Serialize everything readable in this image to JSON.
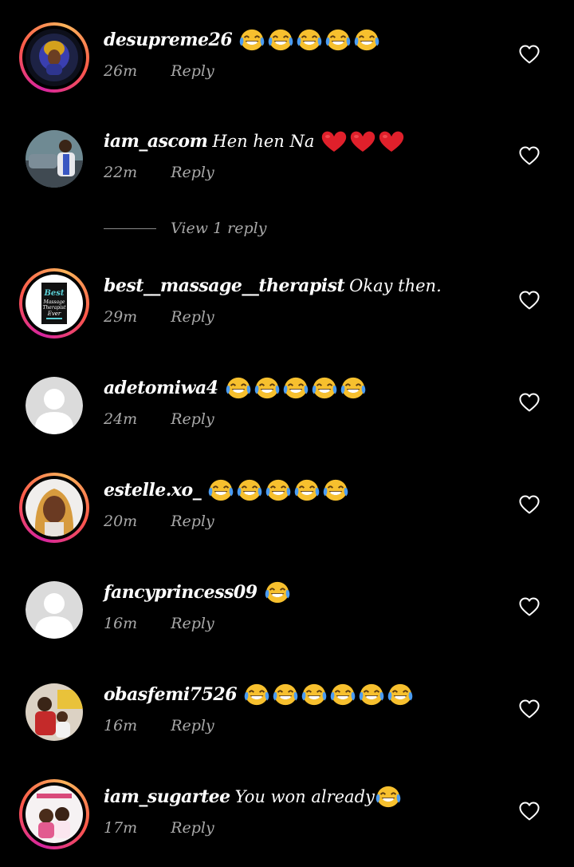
{
  "comments": [
    {
      "username": "desupreme26",
      "text": "",
      "emoji": "joy",
      "emoji_count": 5,
      "time": "26m",
      "reply_label": "Reply",
      "story_ring": true,
      "avatar": "woman-headwrap"
    },
    {
      "username": "iam_ascom",
      "text": "Hen hen Na",
      "emoji": "heart",
      "emoji_count": 3,
      "time": "22m",
      "reply_label": "Reply",
      "story_ring": false,
      "avatar": "man-car"
    },
    {
      "username": "best__massage__therapist",
      "text": "Okay then.",
      "emoji": "",
      "emoji_count": 0,
      "time": "29m",
      "reply_label": "Reply",
      "story_ring": true,
      "avatar": "mug-logo"
    },
    {
      "username": "adetomiwa4",
      "text": "",
      "emoji": "joy",
      "emoji_count": 5,
      "time": "24m",
      "reply_label": "Reply",
      "story_ring": false,
      "avatar": "default-person"
    },
    {
      "username": "estelle.xo_",
      "text": "",
      "emoji": "joy",
      "emoji_count": 5,
      "time": "20m",
      "reply_label": "Reply",
      "story_ring": true,
      "avatar": "woman-selfie"
    },
    {
      "username": "fancyprincess09",
      "text": "",
      "emoji": "joy",
      "emoji_count": 1,
      "time": "16m",
      "reply_label": "Reply",
      "story_ring": false,
      "avatar": "default-person"
    },
    {
      "username": "obasfemi7526",
      "text": "",
      "emoji": "joy",
      "emoji_count": 6,
      "time": "16m",
      "reply_label": "Reply",
      "story_ring": false,
      "avatar": "family-photo"
    },
    {
      "username": "iam_sugartee",
      "text": "You won already",
      "emoji": "joy",
      "emoji_count": 1,
      "time": "17m",
      "reply_label": "Reply",
      "story_ring": true,
      "avatar": "couple-flyer"
    }
  ],
  "view_replies_label": "View 1 reply",
  "colors": {
    "background": "#000000",
    "secondary_text": "#a8a8a8",
    "story_ring_start": "#d6249f",
    "story_ring_end": "#fdb45b"
  },
  "icons": {
    "like": "heart-outline-icon",
    "joy_emoji": "face-with-tears-of-joy",
    "heart_emoji": "red-heart"
  }
}
